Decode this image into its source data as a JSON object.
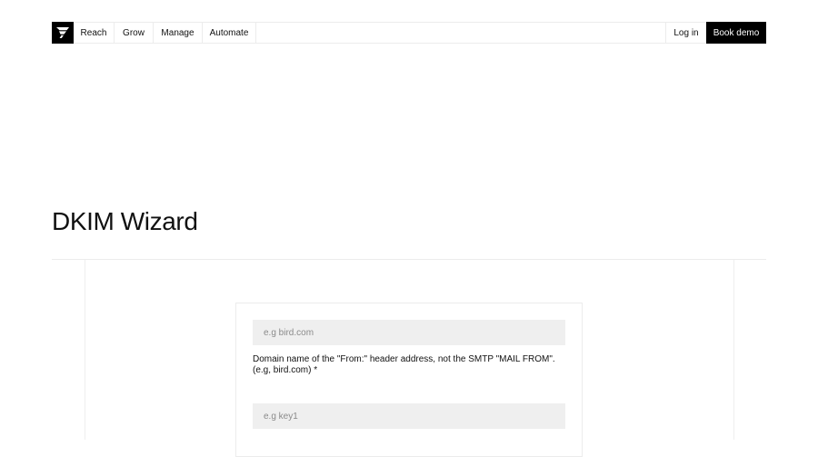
{
  "nav": {
    "logo_icon": "bird-logo-icon",
    "items": [
      {
        "label": "Reach"
      },
      {
        "label": "Grow"
      },
      {
        "label": "Manage"
      },
      {
        "label": "Automate"
      }
    ],
    "login_label": "Log in",
    "demo_label": "Book demo"
  },
  "page": {
    "title": "DKIM Wizard"
  },
  "form": {
    "domain": {
      "placeholder": "e.g bird.com",
      "value": "",
      "help": "Domain name of the \"From:\" header address, not the SMTP \"MAIL FROM\". (e.g, bird.com) *"
    },
    "selector": {
      "placeholder": "e.g key1",
      "value": ""
    }
  },
  "colors": {
    "text": "#111111",
    "button_bg": "#000000",
    "button_text": "#ffffff",
    "input_bg": "#efefef",
    "border": "#ececec",
    "placeholder": "#8a8a8a"
  }
}
